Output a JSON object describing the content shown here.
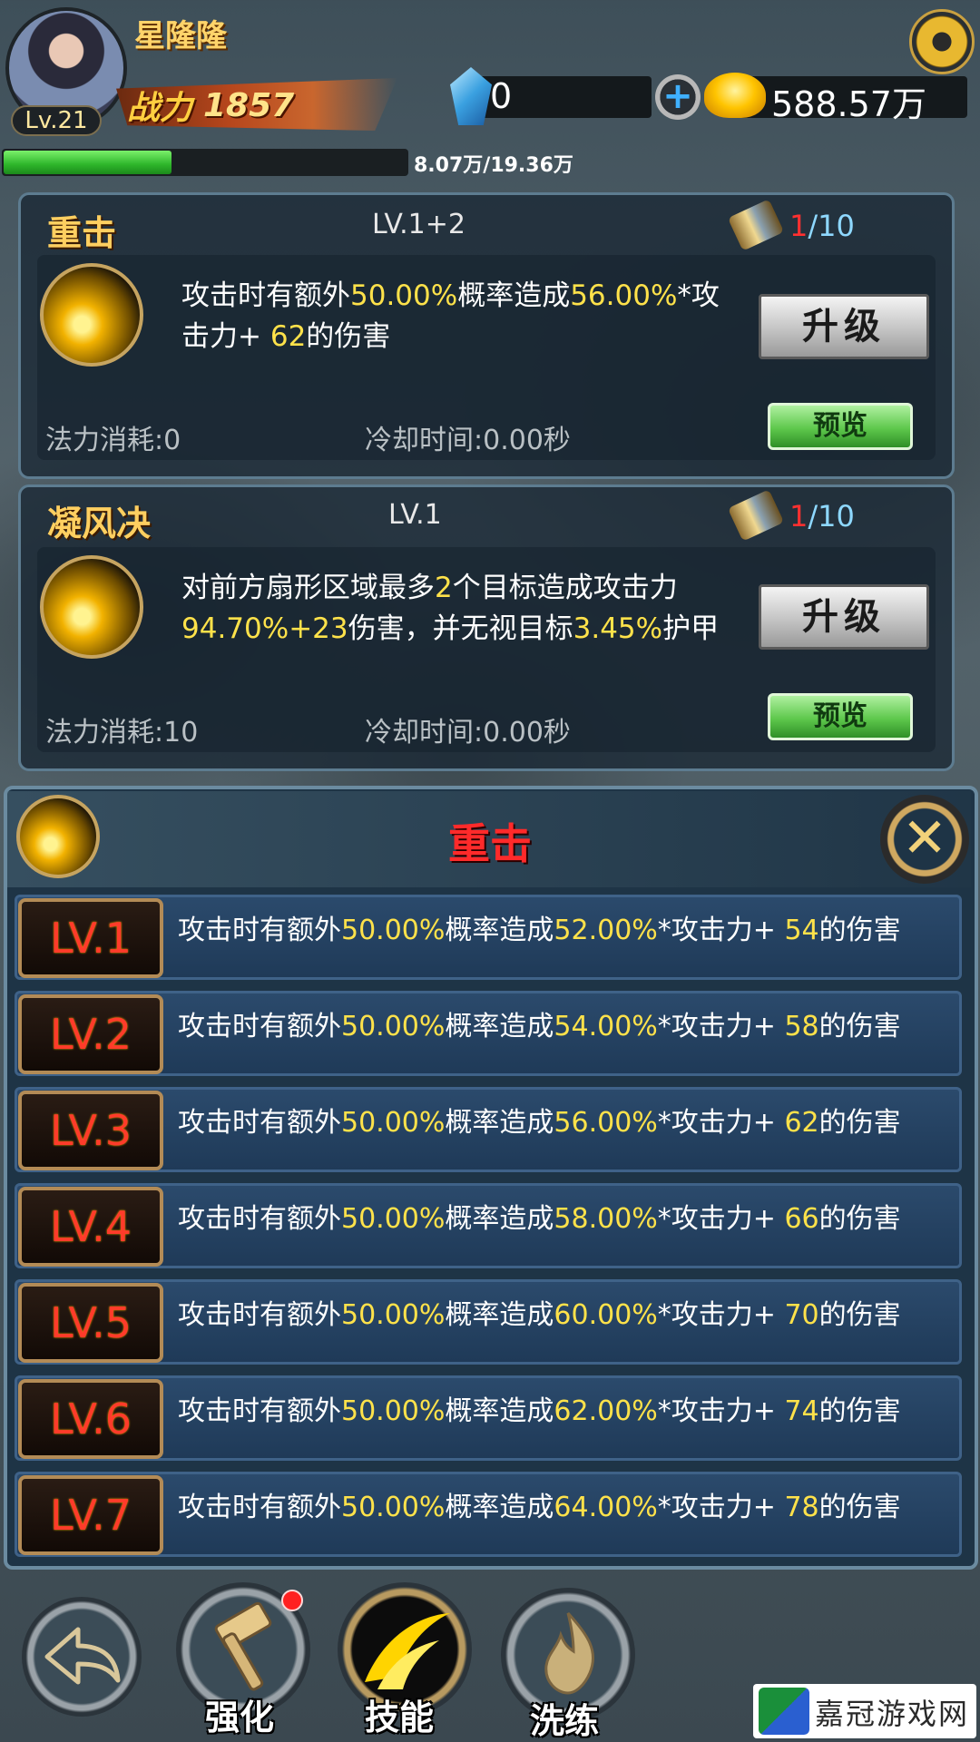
{
  "player": {
    "name": "星隆隆",
    "level": "Lv.21",
    "power_label": "战力",
    "power": "1857",
    "gems": "0",
    "gold": "588.57万",
    "xp_text": "8.07万/19.36万",
    "xp_progress": 0.417
  },
  "skills": [
    {
      "name": "重击",
      "level": "LV.1+2",
      "scroll_have": "1",
      "scroll_need": "/10",
      "desc": [
        {
          "t": "攻击时有额外",
          "h": false
        },
        {
          "t": "50.00%",
          "h": true
        },
        {
          "t": "概率造成",
          "h": false
        },
        {
          "t": "56.00%",
          "h": true
        },
        {
          "t": "*攻击力+ ",
          "h": false
        },
        {
          "t": "62",
          "h": true
        },
        {
          "t": "的伤害",
          "h": false
        }
      ],
      "cost": "法力消耗:0",
      "cooldown": "冷却时间:0.00秒",
      "upgrade_label": "升级",
      "preview_label": "预览"
    },
    {
      "name": "凝风决",
      "level": "LV.1",
      "scroll_have": "1",
      "scroll_need": "/10",
      "desc": [
        {
          "t": "对前方扇形区域最多",
          "h": false
        },
        {
          "t": "2",
          "h": true
        },
        {
          "t": "个目标造成攻击力",
          "h": false
        },
        {
          "t": "94.70%",
          "h": true
        },
        {
          "t": "+23",
          "h": true
        },
        {
          "t": "伤害，并无视目标",
          "h": false
        },
        {
          "t": "3.45%",
          "h": true
        },
        {
          "t": "护甲",
          "h": false
        }
      ],
      "cost": "法力消耗:10",
      "cooldown": "冷却时间:0.00秒",
      "upgrade_label": "升级",
      "preview_label": "预览"
    }
  ],
  "preview_panel": {
    "title": "重击",
    "close_label": "✕",
    "levels": [
      {
        "tag": "LV.1",
        "rate": "50.00%",
        "mult": "52.00%",
        "atk": "54"
      },
      {
        "tag": "LV.2",
        "rate": "50.00%",
        "mult": "54.00%",
        "atk": "58"
      },
      {
        "tag": "LV.3",
        "rate": "50.00%",
        "mult": "56.00%",
        "atk": "62"
      },
      {
        "tag": "LV.4",
        "rate": "50.00%",
        "mult": "58.00%",
        "atk": "66"
      },
      {
        "tag": "LV.5",
        "rate": "50.00%",
        "mult": "60.00%",
        "atk": "70"
      },
      {
        "tag": "LV.6",
        "rate": "50.00%",
        "mult": "62.00%",
        "atk": "74"
      },
      {
        "tag": "LV.7",
        "rate": "50.00%",
        "mult": "64.00%",
        "atk": "78"
      }
    ],
    "text_a": "攻击时有额外",
    "text_b": "概率造成",
    "text_c": "*攻击力+ ",
    "text_d": "的伤害"
  },
  "nav": {
    "back_icon": "back-arrow-icon",
    "enhance": "强化",
    "skills": "技能",
    "refine": "洗练"
  },
  "watermark": "嘉冠游戏网",
  "colors": {
    "highlight": "#ffe24a",
    "level_tag": "#ff3b2a",
    "skill_name": "#ffcf60"
  }
}
